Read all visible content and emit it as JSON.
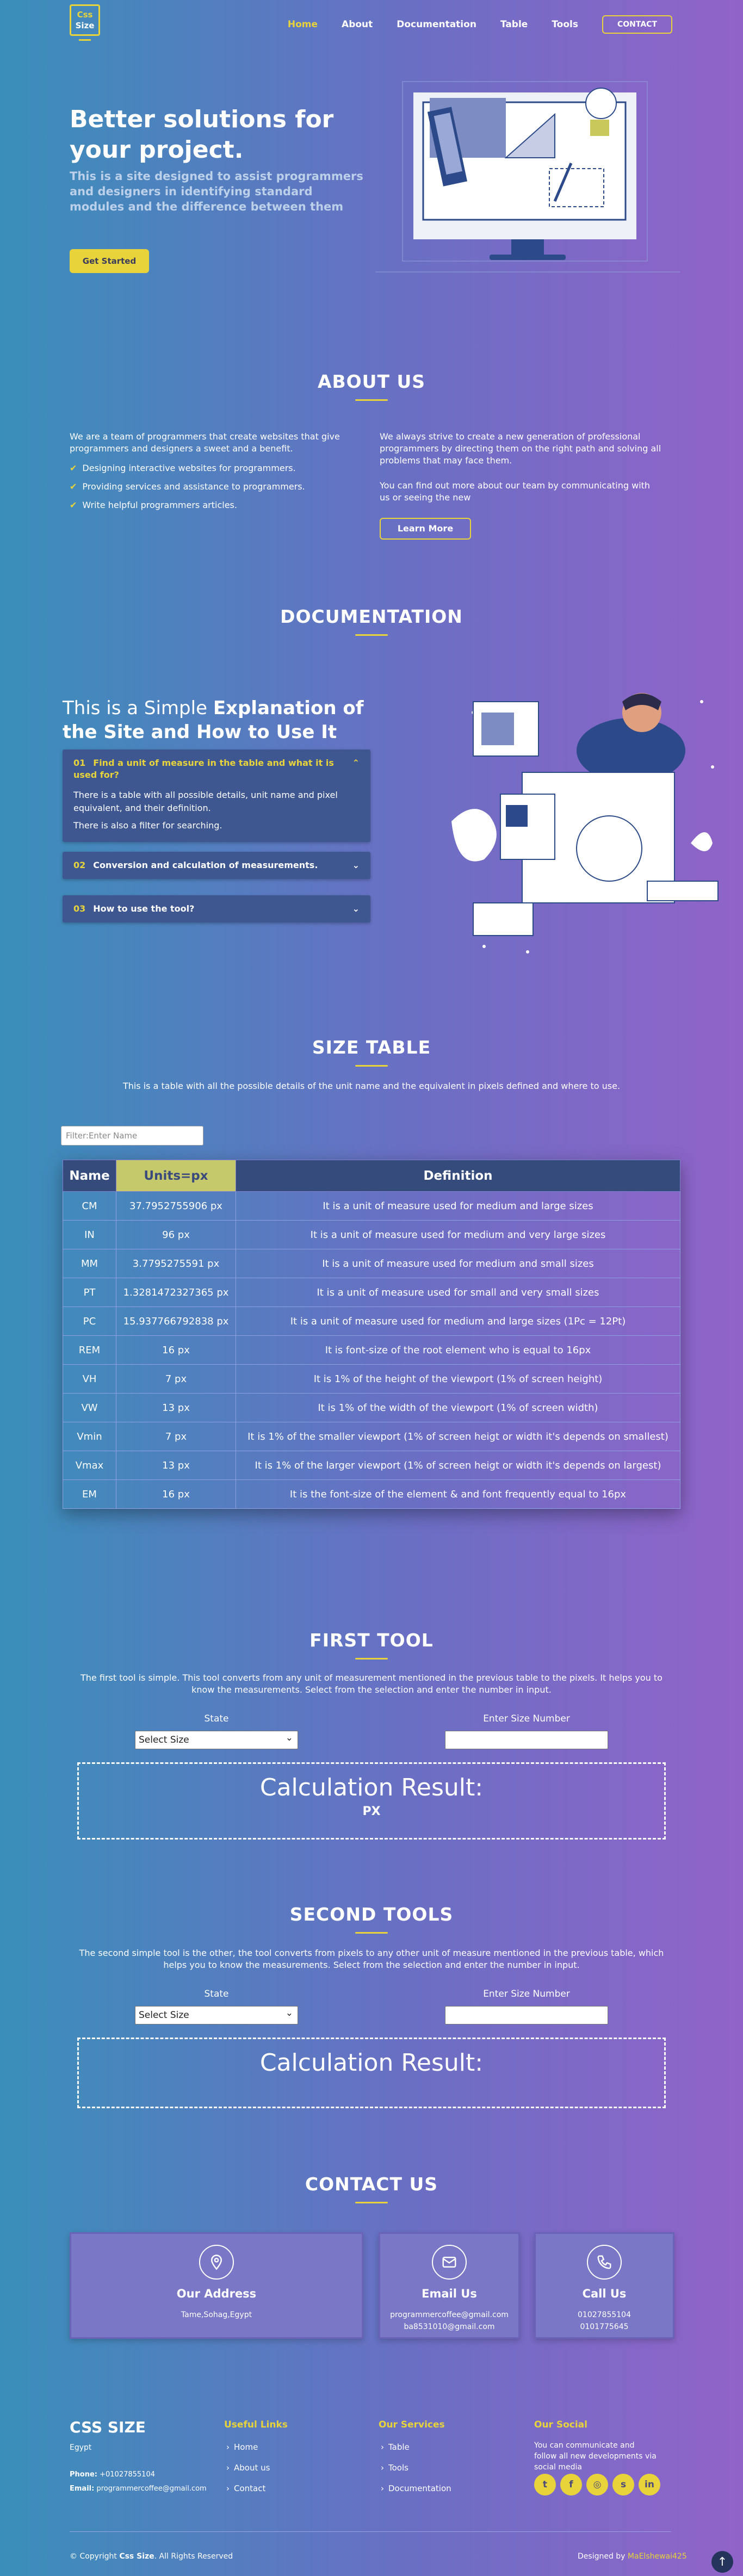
{
  "logo": {
    "line1": "Css",
    "line2": "Size"
  },
  "nav": {
    "home": "Home",
    "about": "About",
    "documentation": "Documentation",
    "table": "Table",
    "tools": "Tools",
    "contact": "CONTACT"
  },
  "hero": {
    "title": "Better solutions for your project.",
    "subtitle": "This is a site designed to assist programmers and designers in identifying standard modules and the difference between them",
    "cta": "Get Started"
  },
  "about": {
    "title": "ABOUT US",
    "intro": "We are a team of programmers that create websites that give programmers and designers a sweet and a benefit.",
    "points": [
      "Designing interactive websites for programmers.",
      "Providing services and assistance to programmers.",
      "Write helpful programmers articles."
    ],
    "right_p1": "We always strive to create a new generation of professional programmers by directing them on the right path and solving all problems that may face them.",
    "right_p2": "You can find out more about our team by communicating with us or seeing the new",
    "learn_more": "Learn More"
  },
  "docs": {
    "title": "DOCUMENTATION",
    "heading_plain": "This is a Simple ",
    "heading_bold": "Explanation of the Site and How to Use It",
    "items": [
      {
        "num": "01",
        "q": "Find a unit of measure in the table and what it is used for?",
        "a1": "There is a table with all possible details, unit name and pixel equivalent, and their definition.",
        "a2": "There is also a filter for searching."
      },
      {
        "num": "02",
        "q": "Conversion and calculation of measurements."
      },
      {
        "num": "03",
        "q": "How to use the tool?"
      }
    ]
  },
  "table": {
    "title": "SIZE TABLE",
    "desc": "This is a table with all the possible details of the unit name and the equivalent in pixels defined and where to use.",
    "filter_placeholder": "Filter:Enter Name",
    "headers": [
      "Name",
      "Units=px",
      "Definition"
    ],
    "rows": [
      [
        "CM",
        "37.7952755906 px",
        "It is a unit of measure used for medium and large sizes"
      ],
      [
        "IN",
        "96 px",
        "It is a unit of measure used for medium and very large sizes"
      ],
      [
        "MM",
        "3.7795275591 px",
        "It is a unit of measure used for medium and small sizes"
      ],
      [
        "PT",
        "1.3281472327365 px",
        "It is a unit of measure used for small and very small sizes"
      ],
      [
        "PC",
        "15.937766792838 px",
        "It is a unit of measure used for medium and large sizes (1Pc = 12Pt)"
      ],
      [
        "REM",
        "16 px",
        "It is font-size of the root element who is equal to 16px"
      ],
      [
        "VH",
        "7 px",
        "It is 1% of the height of the viewport (1% of screen height)"
      ],
      [
        "VW",
        "13 px",
        "It is 1% of the width of the viewport (1% of screen width)"
      ],
      [
        "Vmin",
        "7 px",
        "It is 1% of the smaller viewport (1% of screen heigt or width it's depends on smallest)"
      ],
      [
        "Vmax",
        "13 px",
        "It is 1% of the larger viewport (1% of screen heigt or width it's depends on largest)"
      ],
      [
        "EM",
        "16 px",
        "It is the font-size of the element & and font frequently equal to 16px"
      ]
    ]
  },
  "tool1": {
    "title": "FIRST TOOL",
    "desc": "The first tool is simple. This tool converts from any unit of measurement mentioned in the previous table to the pixels. It helps you to know the measurements. Select from the selection and enter the number in input.",
    "state_label": "State",
    "size_label": "Enter Size Number",
    "select_value": "Select Size",
    "result_title": "Calculation Result:",
    "result_value": "PX"
  },
  "tool2": {
    "title": "SECOND TOOLS",
    "desc": "The second simple tool is the other, the tool converts from pixels to any other unit of measure mentioned in the previous table, which helps you to know the measurements. Select from the selection and enter the number in input.",
    "state_label": "State",
    "size_label": "Enter Size Number",
    "select_value": "Select Size",
    "result_title": "Calculation Result:"
  },
  "contact": {
    "title": "CONTACT US",
    "address_title": "Our Address",
    "address": "Tame,Sohag,Egypt",
    "email_title": "Email Us",
    "email1": "programmercoffee@gmail.com",
    "email2": "ba8531010@gmail.com",
    "call_title": "Call Us",
    "phone1": "01027855104",
    "phone2": "0101775645"
  },
  "footer": {
    "brand": "CSS SIZE",
    "country": "Egypt",
    "phone_label": "Phone:",
    "phone": "+01027855104",
    "email_label": "Email:",
    "email": "programmercoffee@gmail.com",
    "useful_title": "Useful Links",
    "useful": [
      "Home",
      "About us",
      "Contact"
    ],
    "services_title": "Our Services",
    "services": [
      "Table",
      "Tools",
      "Documentation"
    ],
    "social_title": "Our Social",
    "social_text": "You can communicate and follow all new developments via social media",
    "copyright_pre": "© Copyright ",
    "copyright_brand": "Css Size",
    "copyright_post": ". All Rights Reserved",
    "designed_pre": "Designed by ",
    "designed_by": "MaElshewai425"
  },
  "colors": {
    "accent": "#e8d43a",
    "table_header": "#354b7c",
    "units_header": "#c5c96b"
  }
}
